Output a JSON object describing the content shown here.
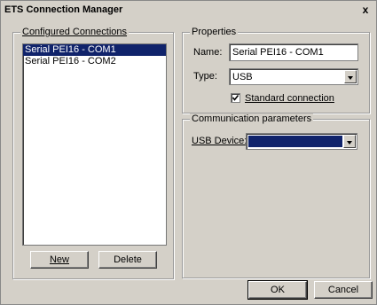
{
  "window": {
    "title": "ETS Connection Manager",
    "close_label": "x"
  },
  "configured_connections": {
    "legend": "Configured Connections",
    "items": [
      {
        "label": "Serial PEI16 - COM1",
        "selected": true
      },
      {
        "label": "Serial PEI16 - COM2",
        "selected": false
      }
    ],
    "new_button": "New",
    "delete_button": "Delete"
  },
  "properties": {
    "legend": "Properties",
    "name_label": "Name:",
    "name_value": "Serial PEI16 - COM1",
    "type_label": "Type:",
    "type_value": "USB",
    "standard_connection_label": "Standard connection",
    "standard_connection_checked": true
  },
  "communication": {
    "legend": "Communication parameters",
    "usb_device_label": "USB Device:",
    "usb_device_value": ""
  },
  "footer": {
    "ok_button": "OK",
    "cancel_button": "Cancel"
  },
  "colors": {
    "selection": "#10236b",
    "dialog_bg": "#d4d0c8"
  }
}
